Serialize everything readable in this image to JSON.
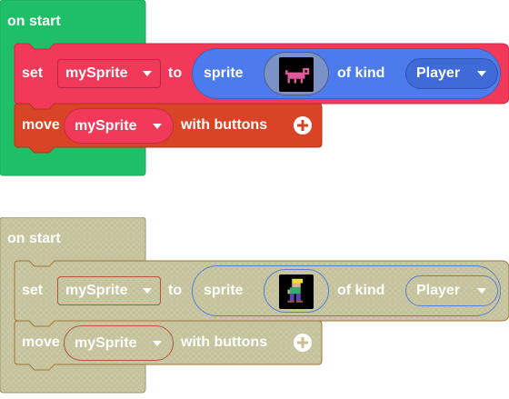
{
  "colors": {
    "events": "#1fbf68",
    "sprites": "#f2395a",
    "controller": "#d94426",
    "sprite_reporter": "#4b7bec",
    "kind_dropdown": "#3e6bd8",
    "disabled_fill": "#d4c99a"
  },
  "blocks": [
    {
      "state": "enabled",
      "hat_label": "on start",
      "set_label": "set",
      "variable": "mySprite",
      "to_label": "to",
      "sprite_label": "sprite",
      "image_icon": "dog-sprite-image",
      "kind_label": "of kind",
      "kind_value": "Player",
      "move_label": "move",
      "move_variable": "mySprite",
      "buttons_label": "with buttons",
      "expand_icon": "plus-circle-icon"
    },
    {
      "state": "disabled",
      "hat_label": "on start",
      "set_label": "set",
      "variable": "mySprite",
      "to_label": "to",
      "sprite_label": "sprite",
      "image_icon": "character-sprite-image",
      "kind_label": "of kind",
      "kind_value": "Player",
      "move_label": "move",
      "move_variable": "mySprite",
      "buttons_label": "with buttons",
      "expand_icon": "plus-circle-icon"
    }
  ]
}
